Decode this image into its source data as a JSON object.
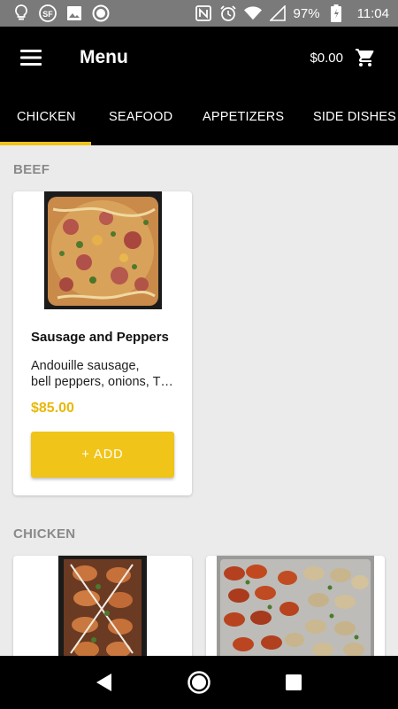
{
  "status_bar": {
    "battery": "97%",
    "time": "11:04",
    "left_icons": [
      "lightbulb-icon",
      "sf-app-icon",
      "image-icon",
      "record-icon"
    ],
    "right_icons": [
      "nfc-icon",
      "alarm-icon",
      "wifi-icon",
      "signal-icon",
      "battery-icon"
    ]
  },
  "app_bar": {
    "title": "Menu",
    "cart_total": "$0.00"
  },
  "tabs": [
    {
      "label": "CHICKEN",
      "active": true
    },
    {
      "label": "SEAFOOD",
      "active": false
    },
    {
      "label": "APPETIZERS",
      "active": false
    },
    {
      "label": "SIDE DISHES",
      "active": false
    }
  ],
  "sections": [
    {
      "title": "BEEF",
      "items": [
        {
          "name": "Sausage and Peppers",
          "description_line1": "Andouille sausage,",
          "description_line2": "bell peppers, onions, T…",
          "price": "$85.00",
          "button_label": "+ ADD"
        }
      ]
    },
    {
      "title": "CHICKEN",
      "items": []
    }
  ],
  "colors": {
    "accent": "#f0c419",
    "price": "#e8b80a",
    "app_bar": "#000000",
    "status_bar": "#7a7a7a",
    "background": "#ebebeb"
  }
}
